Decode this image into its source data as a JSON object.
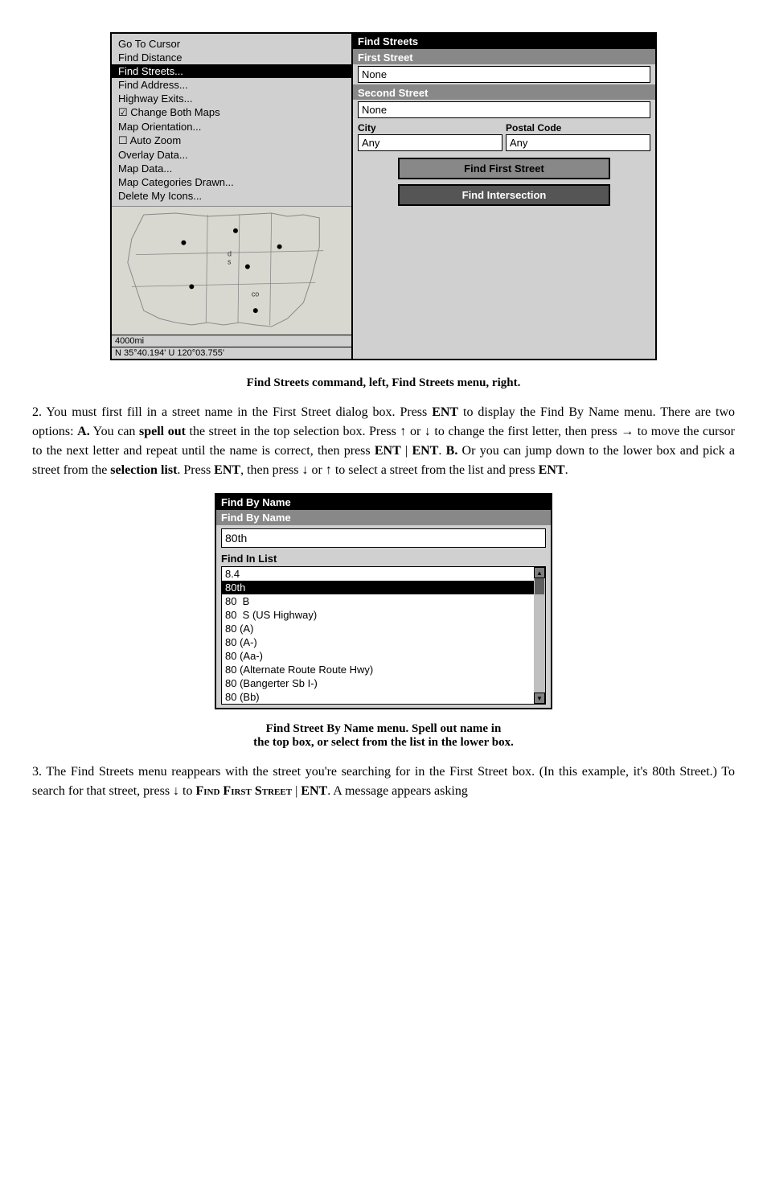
{
  "screenshot1": {
    "left_panel": {
      "menu_items": [
        {
          "label": "Go To Cursor",
          "style": "normal"
        },
        {
          "label": "Find Distance",
          "style": "normal"
        },
        {
          "label": "Find Streets...",
          "style": "highlighted"
        },
        {
          "label": "Find Address...",
          "style": "normal"
        },
        {
          "label": "Highway Exits...",
          "style": "normal"
        },
        {
          "label": "Change Both Maps",
          "style": "checked"
        },
        {
          "label": "Map Orientation...",
          "style": "normal"
        },
        {
          "label": "Auto Zoom",
          "style": "unchecked"
        },
        {
          "label": "Overlay Data...",
          "style": "normal"
        },
        {
          "label": "Map Data...",
          "style": "normal"
        },
        {
          "label": "Map Categories Drawn...",
          "style": "normal"
        },
        {
          "label": "Delete My Icons...",
          "style": "normal"
        }
      ],
      "status": {
        "scale": "4000mi",
        "coords": "N  35°40.194'  U 120°03.755'"
      }
    },
    "right_panel": {
      "title": "Find Streets",
      "first_street_label": "First Street",
      "first_street_value": "None",
      "second_street_label": "Second Street",
      "second_street_value": "None",
      "city_label": "City",
      "city_value": "Any",
      "postal_code_label": "Postal Code",
      "postal_code_value": "Any",
      "find_first_btn": "Find First Street",
      "find_intersection_btn": "Find Intersection"
    }
  },
  "caption1": "Find Streets command, left, Find Streets menu, right.",
  "para1": {
    "text_parts": [
      {
        "text": "2. You must first fill in a street name in the First Street dialog box. Press ",
        "bold": false
      },
      {
        "text": "ENT",
        "bold": true
      },
      {
        "text": " to display the Find By Name menu. There are two options: ",
        "bold": false
      },
      {
        "text": "A.",
        "bold": true
      },
      {
        "text": " You can ",
        "bold": false
      },
      {
        "text": "spell out",
        "bold": true
      },
      {
        "text": " the street in the top selection box. Press ↑ or ↓ to change the first letter, then press → to move the cursor to the next letter and repeat until the name is correct, then press ",
        "bold": false
      },
      {
        "text": "ENT",
        "bold": true
      },
      {
        "text": " | ",
        "bold": false
      },
      {
        "text": "ENT",
        "bold": true
      },
      {
        "text": ". ",
        "bold": false
      },
      {
        "text": "B.",
        "bold": true
      },
      {
        "text": " Or you can jump down to the lower box and pick a street from the ",
        "bold": false
      },
      {
        "text": "selection list",
        "bold": true
      },
      {
        "text": ". Press ",
        "bold": false
      },
      {
        "text": "ENT",
        "bold": true
      },
      {
        "text": ", then press ↓ or ↑ to select a street from the list and press ",
        "bold": false
      },
      {
        "text": "ENT",
        "bold": true
      },
      {
        "text": ".",
        "bold": false
      }
    ]
  },
  "screenshot2": {
    "title": "Find By Name",
    "subtitle": "Find By Name",
    "search_value": "80th",
    "find_in_list_label": "Find In List",
    "list_items": [
      {
        "label": "8.4",
        "selected": false
      },
      {
        "label": "80th",
        "selected": true
      },
      {
        "label": "80  B",
        "selected": false
      },
      {
        "label": "80  S (US Highway)",
        "selected": false
      },
      {
        "label": "80 (A)",
        "selected": false
      },
      {
        "label": "80 (A-)",
        "selected": false
      },
      {
        "label": "80 (Aa-)",
        "selected": false
      },
      {
        "label": "80 (Alternate Route Route Hwy)",
        "selected": false
      },
      {
        "label": "80 (Bangerter Sb I-)",
        "selected": false
      },
      {
        "label": "80 (Bb)",
        "selected": false
      }
    ]
  },
  "caption2_line1": "Find Street By Name menu. Spell out name in",
  "caption2_line2": "the top box, or select from the list in the lower box.",
  "para3": {
    "text_parts": [
      {
        "text": "3. The Find Streets menu reappears with the street you're searching for in the First Street box. (In this example, it's 80th Street.) To search for that street, press ↓ to ",
        "bold": false
      },
      {
        "text": "Find First Street",
        "bold": true,
        "smallcaps": true
      },
      {
        "text": " | ",
        "bold": false
      },
      {
        "text": "ENT",
        "bold": true
      },
      {
        "text": ". A message appears asking",
        "bold": false
      }
    ]
  }
}
